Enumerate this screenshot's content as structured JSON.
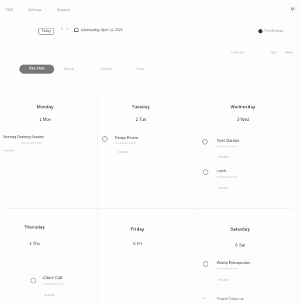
{
  "menu": [
    "CMS",
    "Settings",
    "Support"
  ],
  "menu_right": "M",
  "toolbar": {
    "today_label": "Today",
    "prev_glyph": "‹",
    "next_glyph": "›",
    "date_range": "Wednesday, April 14, 2026",
    "search_text": "Find Events"
  },
  "subnav": [
    "Calendar",
    "Day",
    "Week"
  ],
  "views": {
    "active": "Day View",
    "others": [
      "Week",
      "Month",
      "Year"
    ]
  },
  "days": [
    {
      "name": "Monday",
      "num": "1 Mon"
    },
    {
      "name": "Tuesday",
      "num": "2 Tue"
    },
    {
      "name": "Wednesday",
      "num": "3 Wed"
    },
    {
      "name": "Thursday",
      "num": "4 Thu"
    },
    {
      "name": "Friday",
      "num": "5 Fri"
    },
    {
      "name": "Saturday",
      "num": "6 Sat"
    }
  ],
  "events": {
    "e1": {
      "title": "Morning Planning Session",
      "sub": "Scheduled event",
      "meta": "9:00 AM"
    },
    "e2": {
      "title": "Design Review",
      "sub": "Scheduled event",
      "meta": "9:00 AM"
    },
    "e3": {
      "title": "Team Standup",
      "sub": "Scheduled event",
      "meta": "9:00 AM"
    },
    "e4": {
      "title": "Lunch",
      "sub": "Scheduled event",
      "meta": "9:00 AM"
    },
    "e5": {
      "title": "Client Call",
      "sub": "Scheduled event",
      "meta": "9:00 AM"
    },
    "e6": {
      "title": "Weekly Retrospective",
      "sub": "Scheduled event",
      "meta": "9:00 AM"
    },
    "e7": {
      "title": "Project Follow-up"
    }
  }
}
